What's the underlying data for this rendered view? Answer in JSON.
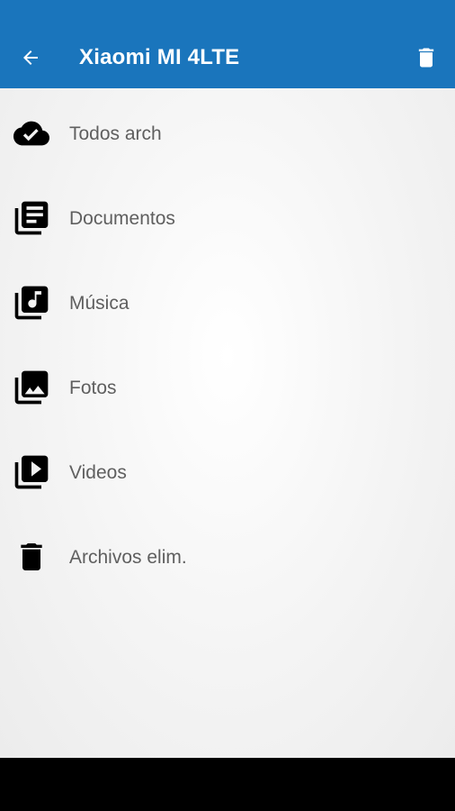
{
  "appbar": {
    "title": "Xiaomi MI 4LTE",
    "back_icon": "arrow-back-icon",
    "action_icon": "trash-icon",
    "color": "#1a75bc"
  },
  "menu": {
    "items": [
      {
        "label": "Todos arch",
        "icon": "cloud-check-icon"
      },
      {
        "label": "Documentos",
        "icon": "library-books-icon"
      },
      {
        "label": "Música",
        "icon": "library-music-icon"
      },
      {
        "label": "Fotos",
        "icon": "photo-library-icon"
      },
      {
        "label": "Videos",
        "icon": "video-library-icon"
      },
      {
        "label": "Archivos elim.",
        "icon": "trash-icon"
      }
    ]
  }
}
